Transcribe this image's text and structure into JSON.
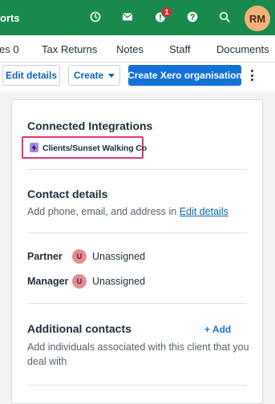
{
  "header": {
    "brand_fragment": "orts",
    "notification_count": "1",
    "avatar_initials": "RM",
    "icons": [
      "clock-icon",
      "mail-icon",
      "notification-icon",
      "help-icon",
      "search-icon"
    ],
    "bg_color": "#1a8a4c"
  },
  "tabs": [
    {
      "label": "es 0"
    },
    {
      "label": "Tax Returns"
    },
    {
      "label": "Notes"
    },
    {
      "label": "Staff"
    },
    {
      "label": "Documents"
    }
  ],
  "toolbar": {
    "edit_details": "Edit details",
    "create": "Create",
    "create_xero": "Create Xero organisation"
  },
  "integrations": {
    "title": "Connected Integrations",
    "item_label": "Clients/Sunset Walking Co"
  },
  "contact_details": {
    "title": "Contact details",
    "text": "Add phone, email, and address in ",
    "link": "Edit details"
  },
  "roles": {
    "partner_label": "Partner",
    "partner_initial": "U",
    "partner_value": "Unassigned",
    "manager_label": "Manager",
    "manager_initial": "U",
    "manager_value": "Unassigned"
  },
  "additional_contacts": {
    "title": "Additional contacts",
    "add_label": "+ Add",
    "line1": "Add individuals associated with this client that you",
    "line2": "deal with"
  }
}
